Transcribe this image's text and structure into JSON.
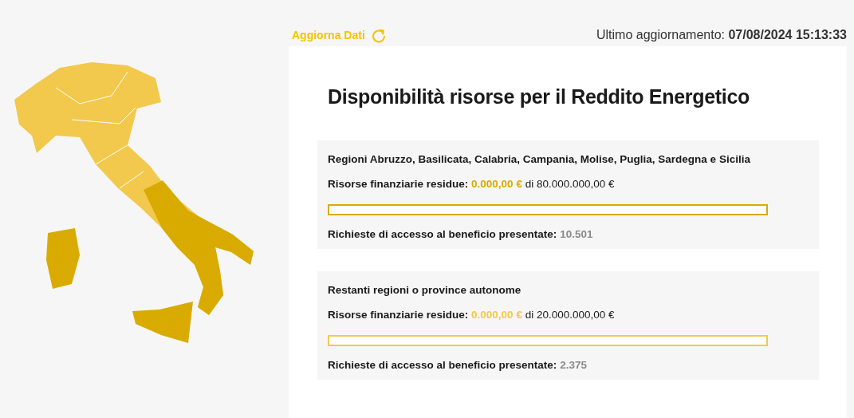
{
  "header": {
    "refresh_link": "Aggiorna Dati",
    "last_update_label": "Ultimo aggiornamento:",
    "last_update_value": "07/08/2024 15:13:33"
  },
  "title": "Disponibilità risorse per il Reddito Energetico",
  "sections": [
    {
      "name": "Regioni Abruzzo, Basilicata, Calabria, Campania, Molise, Puglia, Sardegna e Sicilia",
      "color": "#d9ab00",
      "resources_label": "Risorse finanziarie residue:",
      "resources_amount": "0.000,00 €",
      "resources_total": "di 80.000.000,00 €",
      "level": 0,
      "requests_label": "Richieste di accesso al beneficio presentate:",
      "requests_value": "10.501"
    },
    {
      "name": "Restanti regioni o province autonome",
      "color": "#f2c94c",
      "resources_label": "Risorse finanziarie residue:",
      "resources_amount": "0.000,00 €",
      "resources_total": "di 20.000.000,00 €",
      "level": 0,
      "requests_label": "Richieste di accesso al beneficio presentate:",
      "requests_value": "2.375"
    }
  ]
}
